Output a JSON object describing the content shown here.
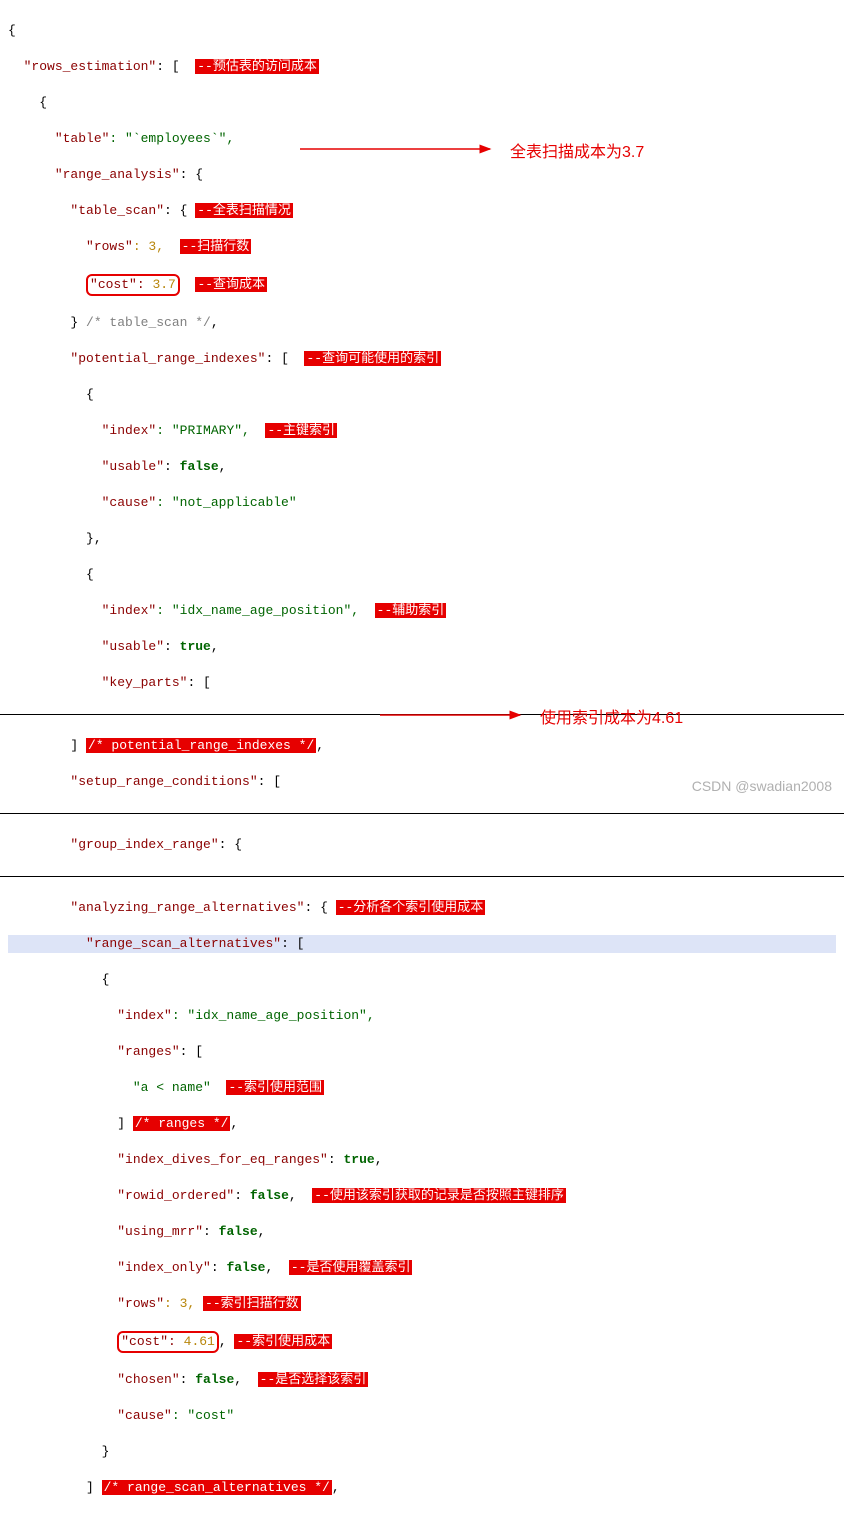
{
  "code": {
    "l1": "{",
    "l2_k": "\"rows_estimation\"",
    "l2_r": ": [  ",
    "l2_h": "--预估表的访问成本",
    "l3": "    {",
    "l4_k": "\"table\"",
    "l4_r": ": \"`employees`\",",
    "l5_k": "\"range_analysis\"",
    "l5_r": ": {",
    "l6_k": "\"table_scan\"",
    "l6_r": ": { ",
    "l6_h": "--全表扫描情况",
    "l7_k": "\"rows\"",
    "l7_r": ": 3,  ",
    "l7_h": "--扫描行数",
    "l8_k": "\"cost\": ",
    "l8_n": "3.7",
    "l8_h": "--查询成本",
    "l9_a": "        } ",
    "l9_c": "/* table_scan */",
    "l9_r": ",",
    "l10_k": "\"potential_range_indexes\"",
    "l10_r": ": [  ",
    "l10_h": "--查询可能使用的索引",
    "l11": "          {",
    "l12_k": "\"index\"",
    "l12_r": ": \"PRIMARY\",  ",
    "l12_h": "--主键索引",
    "l13_k": "\"usable\"",
    "l13_r": ": ",
    "l13_v": "false",
    "l14_k": "\"cause\"",
    "l14_r": ": \"not_applicable\"",
    "l15": "          },",
    "l16": "          {",
    "l17_k": "\"index\"",
    "l17_r": ": \"idx_name_age_position\",  ",
    "l17_h": "--辅助索引",
    "l18_k": "\"usable\"",
    "l18_r": ": ",
    "l18_v": "true",
    "l19_k": "\"key_parts\"",
    "l19_r": ": [",
    "l20": "        ] ",
    "l20_c": "/* potential_range_indexes */",
    "l20_r": ",",
    "l21_k": "\"setup_range_conditions\"",
    "l21_r": ": [",
    "l22_k": "\"group_index_range\"",
    "l22_r": ": {",
    "l23_k": "\"analyzing_range_alternatives\"",
    "l23_r": ": { ",
    "l23_h": "--分析各个索引使用成本",
    "l24_k": "\"range_scan_alternatives\"",
    "l24_r": ": [",
    "l25": "            {",
    "l26_k": "\"index\"",
    "l26_r": ": \"idx_name_age_position\",",
    "l27_k": "\"ranges\"",
    "l27_r": ": [",
    "l28_v": "\"a < name\"",
    "l28_h": "--索引使用范围",
    "l29_a": "              ] ",
    "l29_c": "/* ranges */",
    "l29_r": ",",
    "l30_k": "\"index_dives_for_eq_ranges\"",
    "l30_r": ": ",
    "l30_v": "true",
    "l31_k": "\"rowid_ordered\"",
    "l31_r": ": ",
    "l31_v": "false",
    "l31_h": "--使用该索引获取的记录是否按照主键排序",
    "l32_k": "\"using_mrr\"",
    "l32_r": ": ",
    "l32_v": "false",
    "l33_k": "\"index_only\"",
    "l33_r": ": ",
    "l33_v": "false",
    "l33_h": "--是否使用覆盖索引",
    "l34_k": "\"rows\"",
    "l34_r": ": 3, ",
    "l34_h": "--索引扫描行数",
    "l35_k": "\"cost\": ",
    "l35_n": "4.61",
    "l35_h": "--索引使用成本",
    "l36_k": "\"chosen\"",
    "l36_r": ": ",
    "l36_v": "false",
    "l36_h": "--是否选择该索引",
    "l37_k": "\"cause\"",
    "l37_r": ": \"cost\"",
    "l38": "            }",
    "l39_a": "          ] ",
    "l39_c": "/* range_scan_alternatives */",
    "l39_r": ","
  },
  "annotations": {
    "a1": "全表扫描成本为3.7",
    "a2": "使用索引成本为4.61"
  },
  "watermark": "CSDN @swadian2008"
}
